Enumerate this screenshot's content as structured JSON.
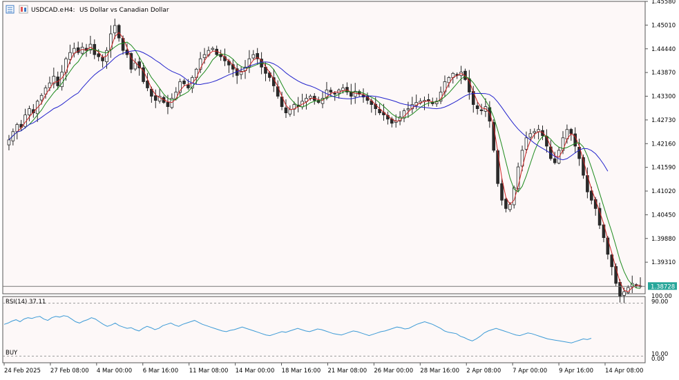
{
  "header": {
    "symbol": "USDCAD.e",
    "timeframe": "H4:",
    "description": "US Dollar vs Canadian Dollar"
  },
  "colors": {
    "background": "#fdf8f8",
    "bull_candle": "#2b2b2b",
    "bear_candle": "#2b2b2b",
    "ma_fast": "#cc2222",
    "ma_mid": "#1c8a1c",
    "ma_slow": "#2222cc",
    "rsi": "#3b9ad6",
    "price_label_bg": "#26a69a"
  },
  "rsi_panel": {
    "label": "RSI(14) 37.11",
    "signal": "BUY",
    "levels": [
      "100.00",
      "90.00",
      "10.00",
      "0.00"
    ]
  },
  "chart_data": {
    "type": "candlestick",
    "timeframe": "H4",
    "y_ticks": [
      "1.45580",
      "1.45010",
      "1.44440",
      "1.43870",
      "1.43300",
      "1.42730",
      "1.42160",
      "1.41590",
      "1.41020",
      "1.40450",
      "1.39880",
      "1.39310"
    ],
    "ylim": [
      1.3855,
      1.4558
    ],
    "x_ticks": [
      "24 Feb 2025",
      "27 Feb 08:00",
      "4 Mar 00:00",
      "6 Mar 16:00",
      "11 Mar 08:00",
      "14 Mar 00:00",
      "18 Mar 16:00",
      "21 Mar 08:00",
      "26 Mar 00:00",
      "28 Mar 16:00",
      "2 Apr 08:00",
      "7 Apr 00:00",
      "9 Apr 16:00",
      "14 Apr 08:00"
    ],
    "current_price": "1.38728",
    "close_series": [
      1.4225,
      1.4245,
      1.4262,
      1.4255,
      1.4285,
      1.43,
      1.429,
      1.4318,
      1.4332,
      1.435,
      1.4362,
      1.4378,
      1.4355,
      1.4388,
      1.442,
      1.4435,
      1.4445,
      1.4435,
      1.4448,
      1.444,
      1.4455,
      1.443,
      1.4425,
      1.4415,
      1.444,
      1.448,
      1.45,
      1.447,
      1.444,
      1.443,
      1.4395,
      1.441,
      1.4398,
      1.4365,
      1.435,
      1.433,
      1.432,
      1.433,
      1.4315,
      1.4305,
      1.4325,
      1.434,
      1.4365,
      1.436,
      1.435,
      1.4375,
      1.4395,
      1.442,
      1.443,
      1.444,
      1.4445,
      1.443,
      1.4425,
      1.4415,
      1.4405,
      1.4395,
      1.438,
      1.439,
      1.44,
      1.442,
      1.443,
      1.442,
      1.44,
      1.4385,
      1.4375,
      1.4355,
      1.433,
      1.4305,
      1.429,
      1.4298,
      1.431,
      1.4305,
      1.4318,
      1.4325,
      1.433,
      1.432,
      1.4315,
      1.4325,
      1.4345,
      1.434,
      1.4335,
      1.4345,
      1.435,
      1.434,
      1.433,
      1.4342,
      1.4335,
      1.4328,
      1.432,
      1.431,
      1.43,
      1.429,
      1.4285,
      1.4275,
      1.4265,
      1.427,
      1.428,
      1.4295,
      1.43,
      1.431,
      1.4315,
      1.4318,
      1.432,
      1.4318,
      1.4312,
      1.4318,
      1.434,
      1.4365,
      1.4375,
      1.4385,
      1.438,
      1.4388,
      1.437,
      1.434,
      1.431,
      1.43,
      1.4295,
      1.4305,
      1.427,
      1.42,
      1.412,
      1.408,
      1.406,
      1.407,
      1.411,
      1.416,
      1.42,
      1.423,
      1.424,
      1.4245,
      1.425,
      1.4235,
      1.421,
      1.418,
      1.417,
      1.42,
      1.423,
      1.425,
      1.424,
      1.421,
      1.418,
      1.414,
      1.41,
      1.408,
      1.406,
      1.402,
      1.399,
      1.395,
      1.392,
      1.388,
      1.385,
      1.386,
      1.387,
      1.388,
      1.3875,
      1.3872
    ],
    "rsi_series": [
      58,
      60,
      63,
      65,
      62,
      66,
      68,
      67,
      69,
      70,
      66,
      64,
      68,
      70,
      69,
      71,
      70,
      66,
      62,
      60,
      63,
      65,
      68,
      66,
      62,
      58,
      55,
      57,
      60,
      56,
      54,
      52,
      53,
      50,
      48,
      52,
      55,
      53,
      50,
      52,
      56,
      58,
      60,
      57,
      55,
      58,
      60,
      62,
      64,
      61,
      58,
      56,
      54,
      52,
      50,
      48,
      47,
      49,
      50,
      52,
      54,
      52,
      50,
      48,
      46,
      44,
      42,
      41,
      43,
      45,
      47,
      46,
      48,
      50,
      52,
      50,
      48,
      47,
      49,
      51,
      50,
      48,
      46,
      44,
      43,
      42,
      44,
      46,
      48,
      47,
      45,
      43,
      41,
      43,
      45,
      47,
      48,
      50,
      52,
      54,
      53,
      51,
      52,
      55,
      58,
      60,
      62,
      60,
      58,
      55,
      52,
      48,
      46,
      45,
      44,
      40,
      38,
      35,
      33,
      36,
      40,
      45,
      48,
      50,
      52,
      50,
      48,
      46,
      44,
      42,
      41,
      43,
      45,
      44,
      42,
      40,
      38,
      36,
      35,
      34,
      33,
      32,
      31,
      30,
      32,
      34,
      36,
      35,
      37
    ]
  }
}
